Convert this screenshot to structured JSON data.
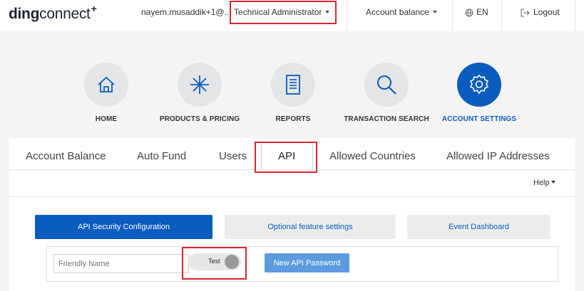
{
  "header": {
    "logo_bold": "ding",
    "logo_light": "connect",
    "logo_plus": "+",
    "user": "nayem.musaddik+1@...",
    "role": "Technical Administrator",
    "account_balance": "Account balance",
    "language": "EN",
    "logout": "Logout"
  },
  "nav": [
    {
      "label": "HOME",
      "icon": "home-icon"
    },
    {
      "label": "PRODUCTS & PRICING",
      "icon": "asterisk-icon"
    },
    {
      "label": "REPORTS",
      "icon": "document-icon"
    },
    {
      "label": "TRANSACTION SEARCH",
      "icon": "search-icon"
    },
    {
      "label": "ACCOUNT SETTINGS",
      "icon": "gear-icon",
      "active": true
    }
  ],
  "tabs": [
    {
      "label": "Account Balance"
    },
    {
      "label": "Auto Fund"
    },
    {
      "label": "Users"
    },
    {
      "label": "API",
      "active": true
    },
    {
      "label": "Allowed Countries"
    },
    {
      "label": "Allowed IP Addresses"
    }
  ],
  "help": "Help",
  "api_buttons": {
    "security": "API Security Configuration",
    "optional": "Optional feature settings",
    "event": "Event Dashboard"
  },
  "form": {
    "friendly_name_placeholder": "Friendly Name",
    "toggle_label": "Test",
    "new_password": "New API Password"
  },
  "colors": {
    "accent": "#0b5cbf",
    "highlight": "#d9262e",
    "light_button": "#5d9bdf"
  }
}
